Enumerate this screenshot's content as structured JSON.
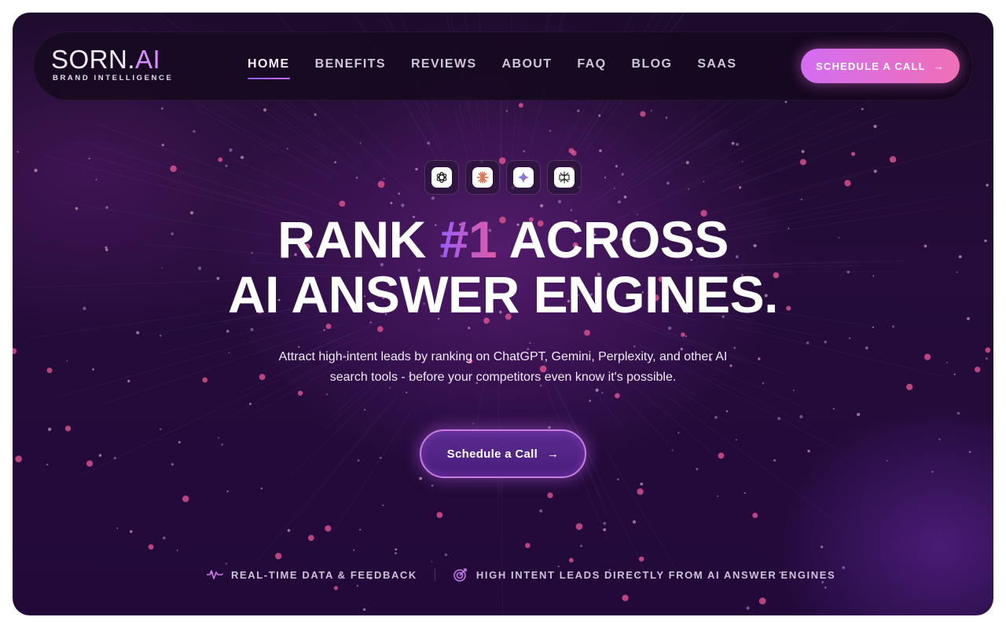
{
  "brand": {
    "name_main": "SORN.",
    "name_accent": "AI",
    "tagline": "BRAND INTELLIGENCE"
  },
  "nav": {
    "items": [
      {
        "label": "HOME",
        "active": true
      },
      {
        "label": "BENEFITS",
        "active": false
      },
      {
        "label": "REVIEWS",
        "active": false
      },
      {
        "label": "ABOUT",
        "active": false
      },
      {
        "label": "FAQ",
        "active": false
      },
      {
        "label": "BLOG",
        "active": false
      },
      {
        "label": "SAAS",
        "active": false
      }
    ],
    "cta_label": "SCHEDULE A CALL",
    "cta_arrow": "→"
  },
  "ai_engines": [
    {
      "icon": "chatgpt-icon"
    },
    {
      "icon": "claude-icon"
    },
    {
      "icon": "gemini-icon"
    },
    {
      "icon": "perplexity-icon"
    }
  ],
  "hero": {
    "line1_before": "RANK ",
    "line1_accent": "#1",
    "line1_after": " ACROSS",
    "line2": "AI ANSWER ENGINES.",
    "subtitle": "Attract high-intent leads by ranking on ChatGPT, Gemini, Perplexity, and other AI search tools - before your competitors even know it's possible.",
    "cta_label": "Schedule a Call",
    "cta_arrow": "→"
  },
  "features": [
    {
      "icon": "pulse-icon",
      "label": "REAL-TIME DATA & FEEDBACK"
    },
    {
      "icon": "target-icon",
      "label": "HIGH INTENT LEADS DIRECTLY FROM AI ANSWER ENGINES"
    }
  ],
  "colors": {
    "background": "#22093a",
    "accent_purple": "#9b5cf6",
    "accent_pink": "#f06fb6",
    "logo_accent": "#d78cff"
  }
}
